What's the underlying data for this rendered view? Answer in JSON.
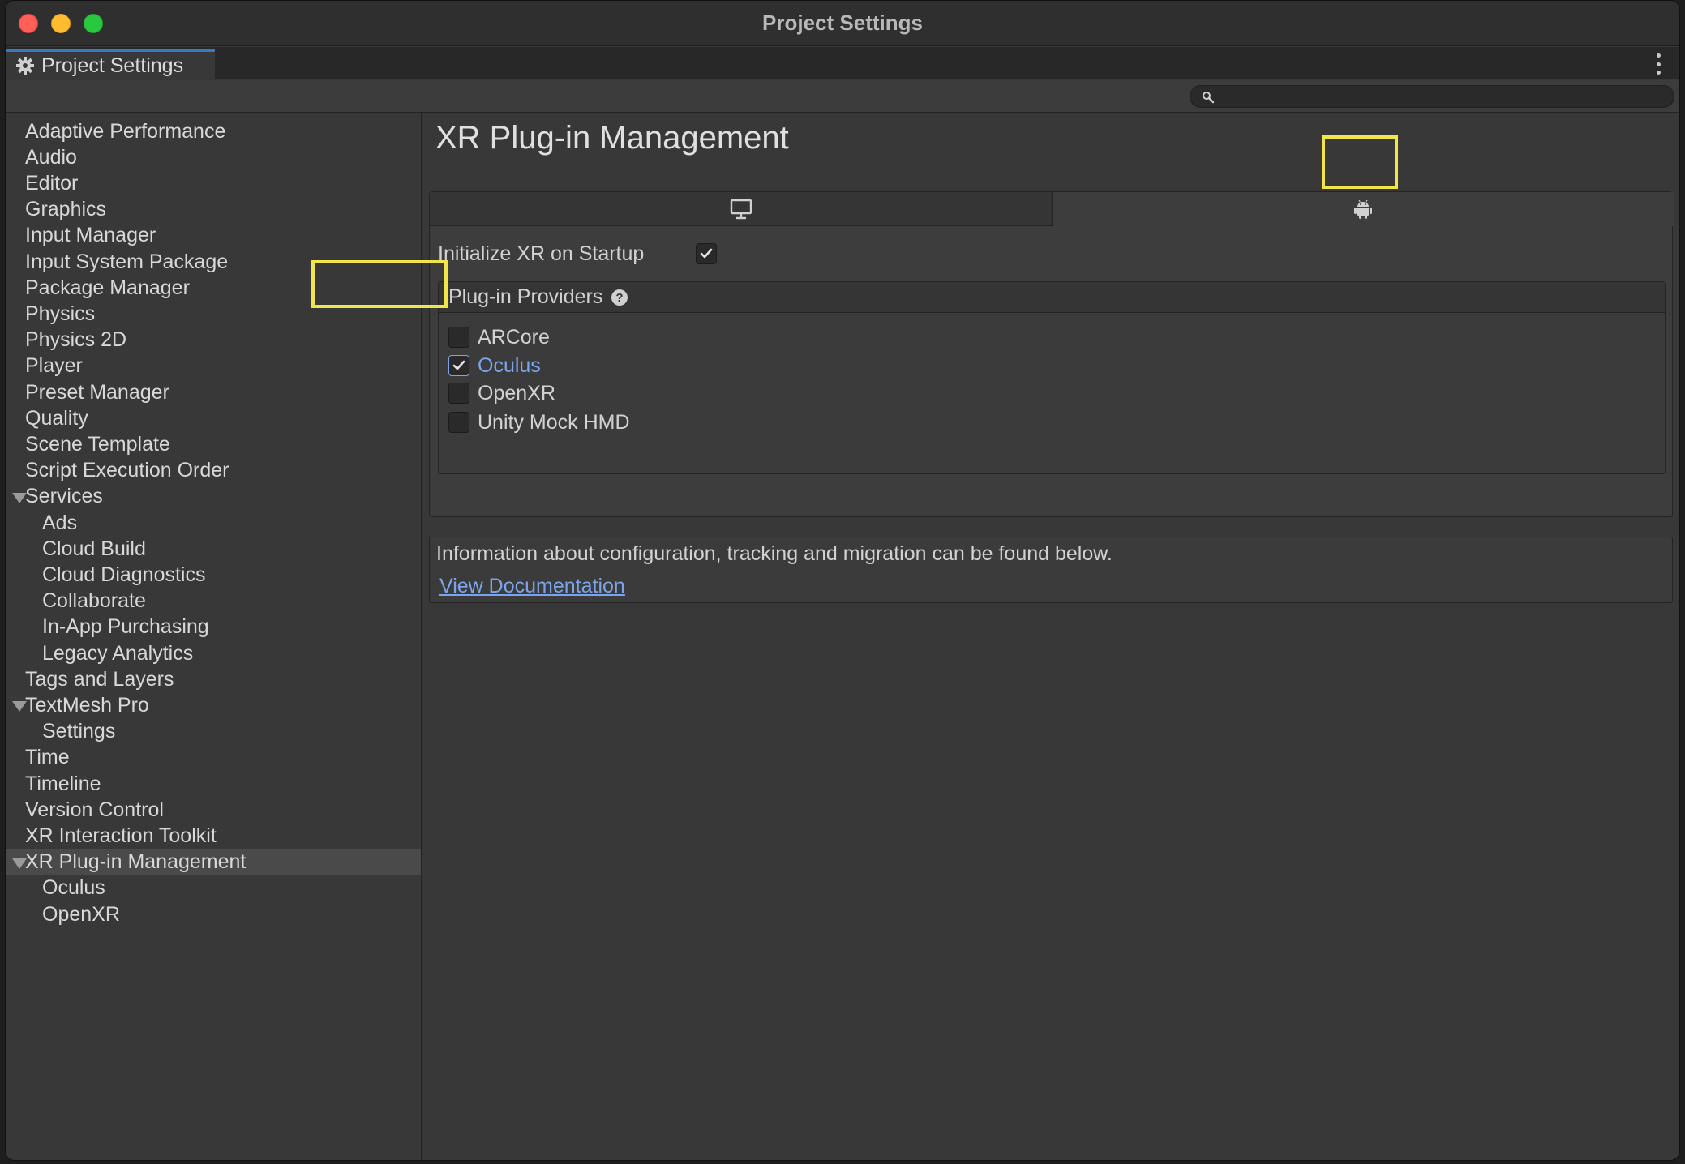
{
  "window": {
    "title": "Project Settings"
  },
  "tab": {
    "label": "Project Settings",
    "icon": "gear-icon"
  },
  "search": {
    "placeholder": "",
    "value": ""
  },
  "sidebar": {
    "items": [
      {
        "label": "Adaptive Performance",
        "indent": 0
      },
      {
        "label": "Audio",
        "indent": 0
      },
      {
        "label": "Editor",
        "indent": 0
      },
      {
        "label": "Graphics",
        "indent": 0
      },
      {
        "label": "Input Manager",
        "indent": 0
      },
      {
        "label": "Input System Package",
        "indent": 0
      },
      {
        "label": "Package Manager",
        "indent": 0
      },
      {
        "label": "Physics",
        "indent": 0
      },
      {
        "label": "Physics 2D",
        "indent": 0
      },
      {
        "label": "Player",
        "indent": 0
      },
      {
        "label": "Preset Manager",
        "indent": 0
      },
      {
        "label": "Quality",
        "indent": 0
      },
      {
        "label": "Scene Template",
        "indent": 0
      },
      {
        "label": "Script Execution Order",
        "indent": 0
      },
      {
        "label": "Services",
        "indent": 0,
        "expanded": true
      },
      {
        "label": "Ads",
        "indent": 1
      },
      {
        "label": "Cloud Build",
        "indent": 1
      },
      {
        "label": "Cloud Diagnostics",
        "indent": 1
      },
      {
        "label": "Collaborate",
        "indent": 1
      },
      {
        "label": "In-App Purchasing",
        "indent": 1
      },
      {
        "label": "Legacy Analytics",
        "indent": 1
      },
      {
        "label": "Tags and Layers",
        "indent": 0
      },
      {
        "label": "TextMesh Pro",
        "indent": 0,
        "expanded": true
      },
      {
        "label": "Settings",
        "indent": 1
      },
      {
        "label": "Time",
        "indent": 0
      },
      {
        "label": "Timeline",
        "indent": 0
      },
      {
        "label": "Version Control",
        "indent": 0
      },
      {
        "label": "XR Interaction Toolkit",
        "indent": 0
      },
      {
        "label": "XR Plug-in Management",
        "indent": 0,
        "expanded": true,
        "selected": true
      },
      {
        "label": "Oculus",
        "indent": 1
      },
      {
        "label": "OpenXR",
        "indent": 1
      }
    ]
  },
  "main": {
    "title": "XR Plug-in Management",
    "platform_tabs": [
      {
        "name": "standalone",
        "icon": "monitor-icon",
        "selected": false
      },
      {
        "name": "android",
        "icon": "android-icon",
        "selected": true
      }
    ],
    "initialize_label": "Initialize XR on Startup",
    "initialize_checked": true,
    "providers_title": "Plug-in Providers",
    "providers": [
      {
        "label": "ARCore",
        "checked": false
      },
      {
        "label": "Oculus",
        "checked": true
      },
      {
        "label": "OpenXR",
        "checked": false
      },
      {
        "label": "Unity Mock HMD",
        "checked": false
      }
    ],
    "info_text": "Information about configuration, tracking and migration can be found below.",
    "doc_link": "View Documentation"
  },
  "colors": {
    "highlight": "#f0e64a",
    "link": "#7ba4ea",
    "tab_accent": "#3a79bb"
  }
}
